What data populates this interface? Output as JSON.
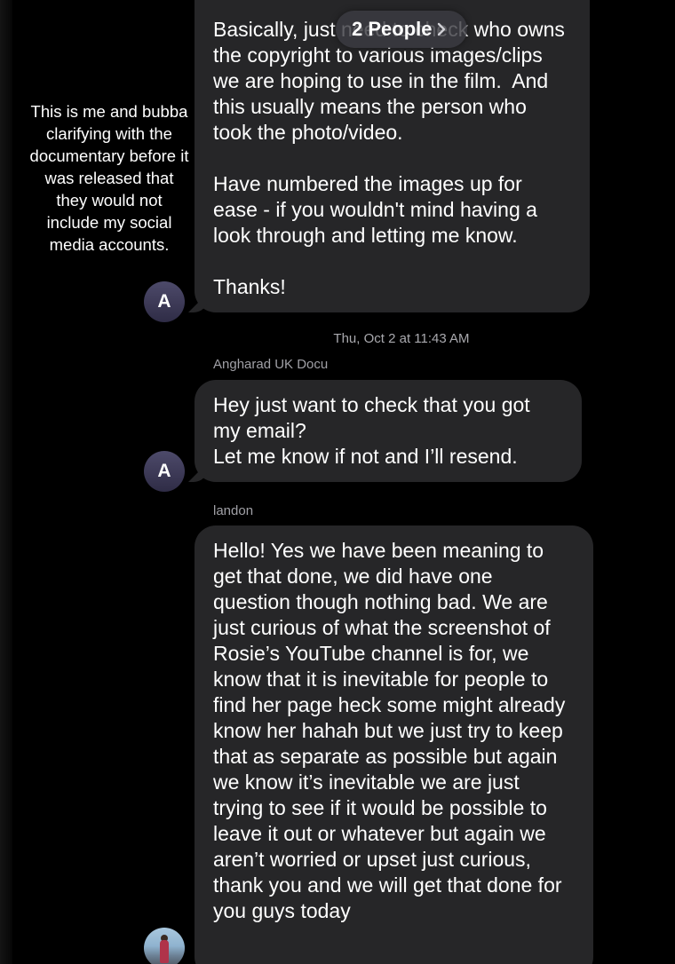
{
  "header": {
    "people_label": "2 People",
    "chevron_icon": "chevron-right-icon"
  },
  "overlay_caption": {
    "lines": [
      "This is me and bubba",
      "clarifying with the",
      "documentary before it",
      "was released that",
      "they would not",
      "include my social",
      "media accounts."
    ]
  },
  "messages": [
    {
      "paragraphs": [
        "Basically, just need to check who owns the copyright to various images/clips we are hoping to use in the film.  And this usually means the person who took the photo/video.",
        "Have numbered the images up for ease - if you wouldn't mind having a look through and letting me know.",
        "Thanks!"
      ],
      "avatar_initial": "A"
    },
    {
      "timestamp": "Thu, Oct 2 at 11:43 AM",
      "sender": "Angharad UK Docu",
      "text": "Hey just want to check that you got my email?\nLet me know if not and I’ll resend.",
      "avatar_initial": "A"
    },
    {
      "sender": "landon",
      "text": "Hello! Yes we have been meaning to get that done, we did have one question though nothing bad. We are just curious of what the screenshot of Rosie’s YouTube channel is for, we know that it is inevitable for people to find her page heck some might already know her hahah but we just try to keep that as separate as possible but again we know it’s inevitable we are just trying to see if it would be possible to leave it out or whatever but again we aren’t worried or upset just curious, thank you and we will get that done for you guys today"
    }
  ],
  "colors": {
    "background": "#000000",
    "bubble": "#262628",
    "avatar": "#3c3957",
    "meta_text": "#a9a9ae"
  }
}
